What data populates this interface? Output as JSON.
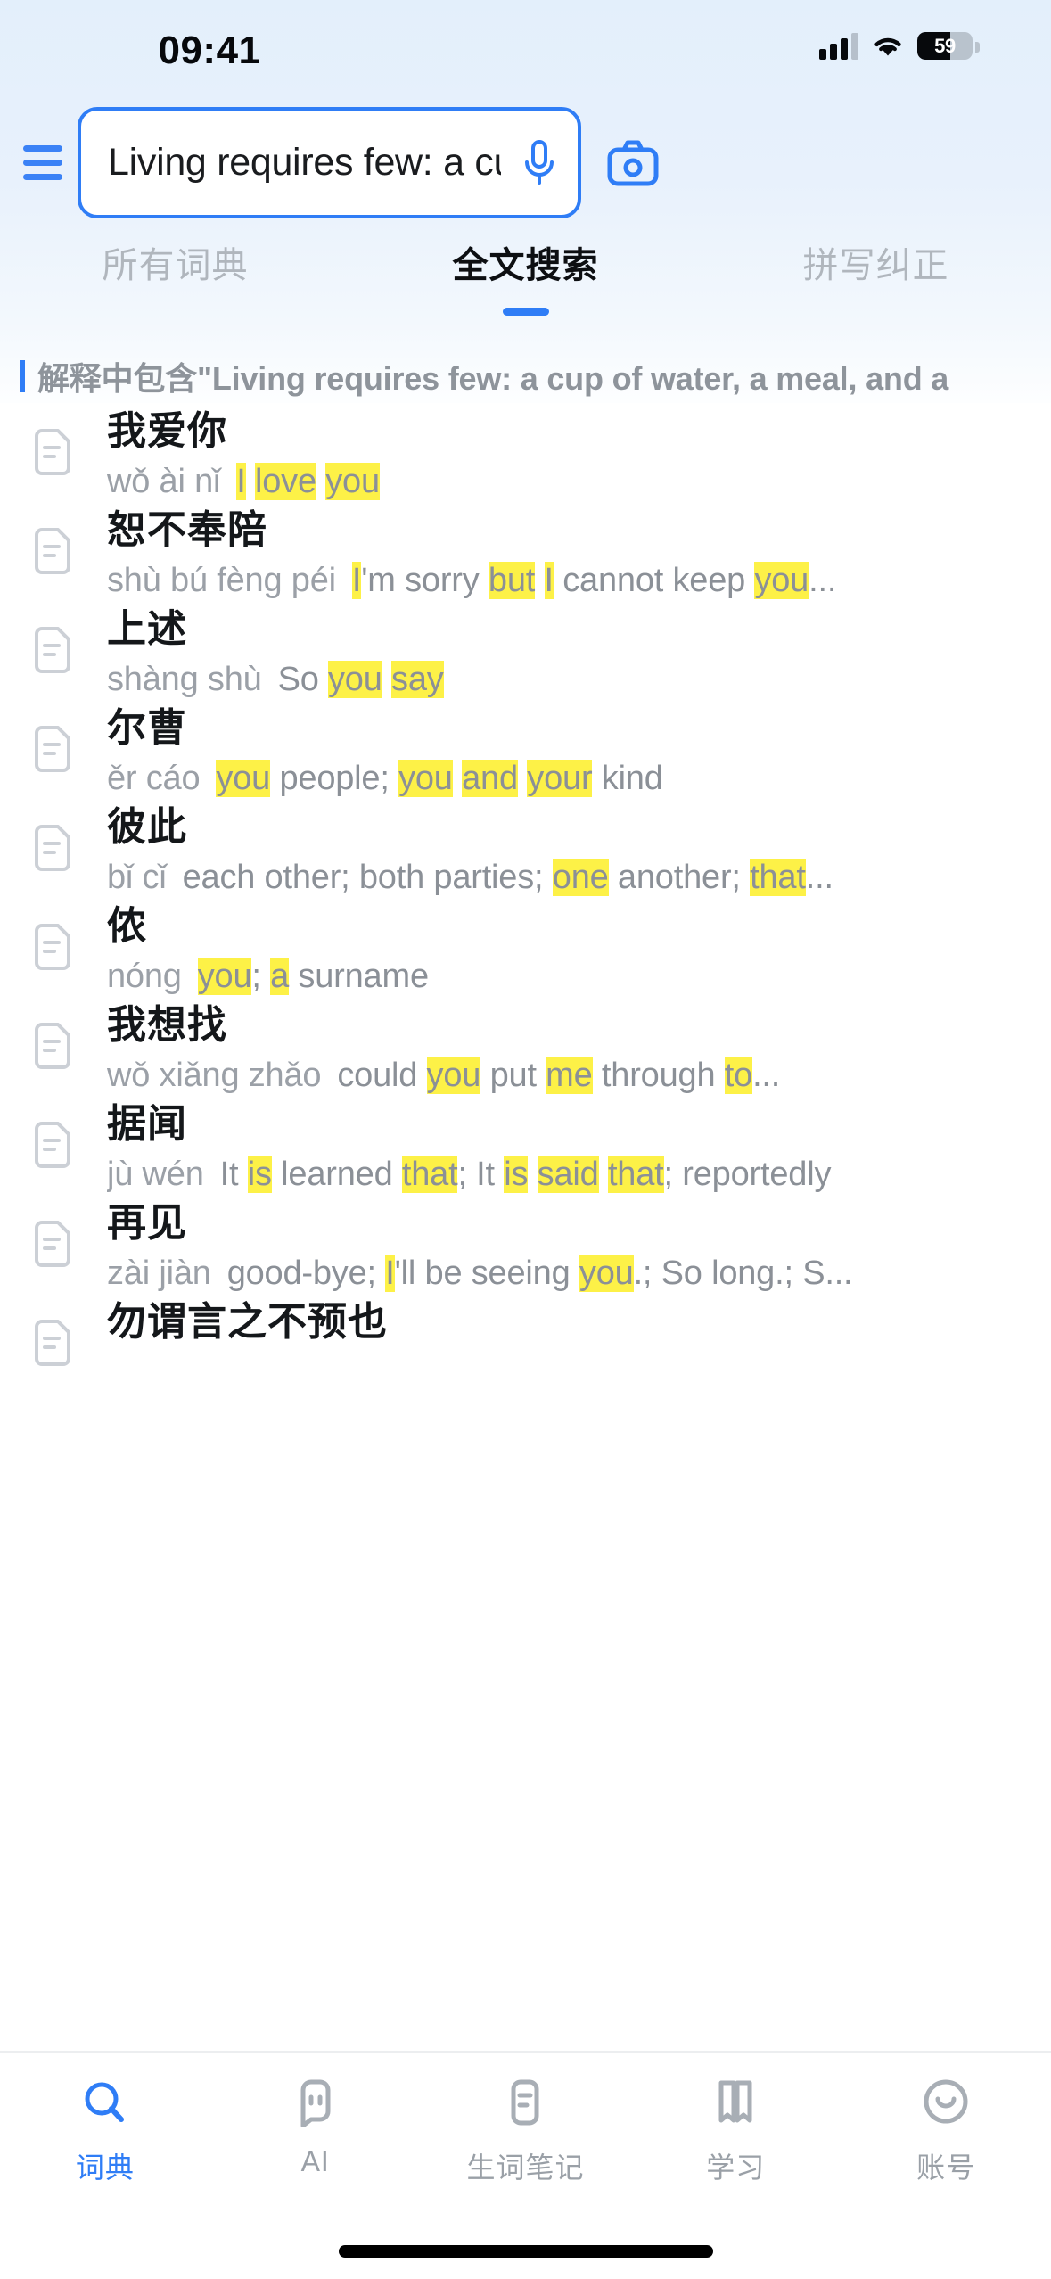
{
  "status_bar": {
    "time": "09:41",
    "battery_level": "59",
    "battery_percent": 59,
    "signal_icon": "cellular-signal-icon",
    "wifi_icon": "wifi-icon",
    "battery_icon": "battery-icon"
  },
  "header": {
    "menu_icon": "hamburger-menu-icon",
    "search": {
      "value": "Living requires few: a cup of...",
      "placeholder": "Living requires few: a cup of...",
      "mic_icon": "microphone-icon"
    },
    "camera_icon": "camera-icon",
    "accent_color": "#2f7df6"
  },
  "tabs": [
    {
      "label": "所有词典",
      "active": false
    },
    {
      "label": "全文搜索",
      "active": true
    },
    {
      "label": "拼写纠正",
      "active": false
    }
  ],
  "banner": {
    "text": "解释中包含\"Living requires few: a cup of water, a meal, and a"
  },
  "highlight_color": "#fdf147",
  "results": [
    {
      "headword": "我爱你",
      "pinyin": "wǒ ài nǐ",
      "parts": [
        {
          "t": "I",
          "h": true
        },
        {
          "t": " ",
          "h": false
        },
        {
          "t": "love",
          "h": true
        },
        {
          "t": " ",
          "h": false
        },
        {
          "t": "you",
          "h": true
        }
      ]
    },
    {
      "headword": "恕不奉陪",
      "pinyin": "shù bú fèng péi",
      "parts": [
        {
          "t": "I",
          "h": true
        },
        {
          "t": "'m sorry ",
          "h": false
        },
        {
          "t": "but",
          "h": true
        },
        {
          "t": " ",
          "h": false
        },
        {
          "t": "I",
          "h": true
        },
        {
          "t": " cannot keep ",
          "h": false
        },
        {
          "t": "you",
          "h": true
        },
        {
          "t": "...",
          "h": false
        }
      ]
    },
    {
      "headword": "上述",
      "pinyin": "shàng shù",
      "parts": [
        {
          "t": "So ",
          "h": false
        },
        {
          "t": "you",
          "h": true
        },
        {
          "t": " ",
          "h": false
        },
        {
          "t": "say",
          "h": true
        }
      ]
    },
    {
      "headword": "尔曹",
      "pinyin": "ěr cáo",
      "parts": [
        {
          "t": "you",
          "h": true
        },
        {
          "t": " people; ",
          "h": false
        },
        {
          "t": "you",
          "h": true
        },
        {
          "t": " ",
          "h": false
        },
        {
          "t": "and",
          "h": true
        },
        {
          "t": " ",
          "h": false
        },
        {
          "t": "your",
          "h": true
        },
        {
          "t": " kind",
          "h": false
        }
      ]
    },
    {
      "headword": "彼此",
      "pinyin": "bǐ cǐ",
      "parts": [
        {
          "t": "each other; both parties; ",
          "h": false
        },
        {
          "t": "one",
          "h": true
        },
        {
          "t": " another; ",
          "h": false
        },
        {
          "t": "that",
          "h": true
        },
        {
          "t": "...",
          "h": false
        }
      ]
    },
    {
      "headword": "侬",
      "pinyin": "nóng",
      "parts": [
        {
          "t": "you",
          "h": true
        },
        {
          "t": "; ",
          "h": false
        },
        {
          "t": "a",
          "h": true
        },
        {
          "t": " surname",
          "h": false
        }
      ]
    },
    {
      "headword": "我想找",
      "pinyin": "wǒ xiǎng zhǎo",
      "parts": [
        {
          "t": "could ",
          "h": false
        },
        {
          "t": "you",
          "h": true
        },
        {
          "t": " put ",
          "h": false
        },
        {
          "t": "me",
          "h": true
        },
        {
          "t": " through ",
          "h": false
        },
        {
          "t": "to",
          "h": true
        },
        {
          "t": "...",
          "h": false
        }
      ]
    },
    {
      "headword": "据闻",
      "pinyin": "jù wén",
      "parts": [
        {
          "t": "It ",
          "h": false
        },
        {
          "t": "is",
          "h": true
        },
        {
          "t": " learned ",
          "h": false
        },
        {
          "t": "that",
          "h": true
        },
        {
          "t": "; It ",
          "h": false
        },
        {
          "t": "is",
          "h": true
        },
        {
          "t": " ",
          "h": false
        },
        {
          "t": "said",
          "h": true
        },
        {
          "t": " ",
          "h": false
        },
        {
          "t": "that",
          "h": true
        },
        {
          "t": "; reportedly",
          "h": false
        }
      ]
    },
    {
      "headword": "再见",
      "pinyin": "zài jiàn",
      "parts": [
        {
          "t": "good-bye; ",
          "h": false
        },
        {
          "t": "I",
          "h": true
        },
        {
          "t": "'ll be seeing ",
          "h": false
        },
        {
          "t": "you",
          "h": true
        },
        {
          "t": ".; So long.; S...",
          "h": false
        }
      ]
    },
    {
      "headword": "勿谓言之不预也",
      "pinyin": "",
      "parts": []
    }
  ],
  "tabbar": [
    {
      "label": "词典",
      "icon": "search-dictionary-icon",
      "active": true
    },
    {
      "label": "AI",
      "icon": "ai-robot-icon",
      "active": false
    },
    {
      "label": "生词笔记",
      "icon": "notebook-icon",
      "active": false
    },
    {
      "label": "学习",
      "icon": "open-book-icon",
      "active": false
    },
    {
      "label": "账号",
      "icon": "account-circle-icon",
      "active": false
    }
  ]
}
